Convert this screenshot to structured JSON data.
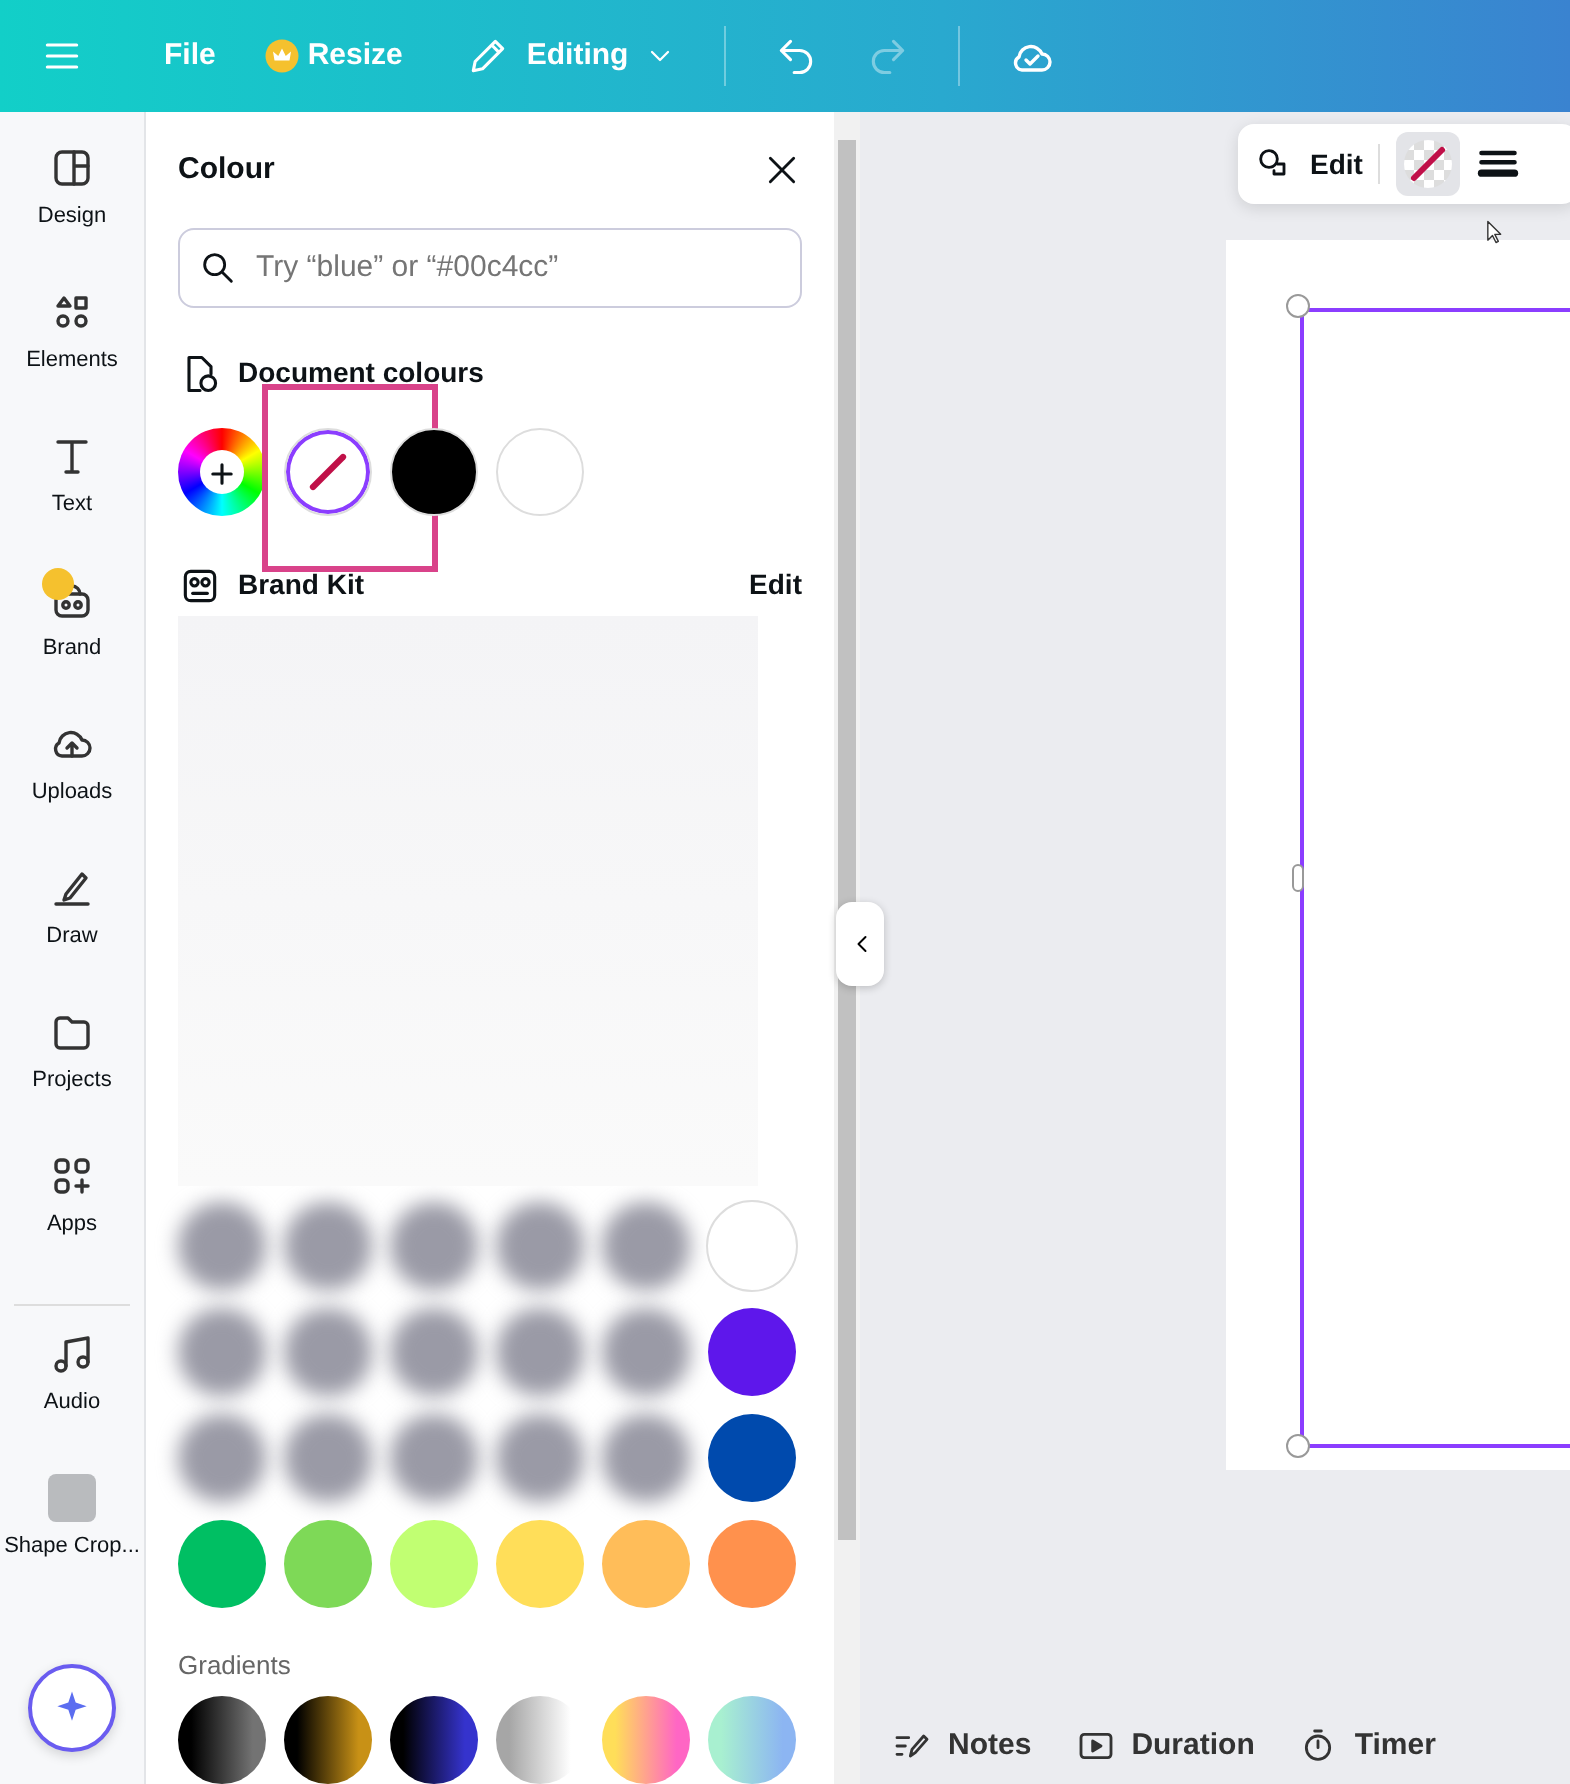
{
  "top_bar": {
    "file_label": "File",
    "resize_label": "Resize",
    "mode_label": "Editing",
    "undo": {
      "disabled": false
    },
    "redo": {
      "disabled": true
    }
  },
  "sidebar": {
    "items": [
      {
        "label": "Design",
        "kind": "design",
        "premium": false
      },
      {
        "label": "Elements",
        "kind": "elements",
        "premium": false
      },
      {
        "label": "Text",
        "kind": "text",
        "premium": false
      },
      {
        "label": "Brand",
        "kind": "brand",
        "premium": true
      },
      {
        "label": "Uploads",
        "kind": "uploads",
        "premium": false
      },
      {
        "label": "Draw",
        "kind": "draw",
        "premium": false
      },
      {
        "label": "Projects",
        "kind": "projects",
        "premium": false
      },
      {
        "label": "Apps",
        "kind": "apps",
        "premium": false
      },
      {
        "label": "Audio",
        "kind": "audio",
        "premium": false
      },
      {
        "label": "Shape Crop...",
        "kind": "thumbnail",
        "premium": false
      }
    ]
  },
  "colour_panel": {
    "title": "Colour",
    "search": {
      "placeholder": "Try “blue” or “#00c4cc”"
    },
    "document_colours": {
      "title": "Document colours",
      "swatches": [
        {
          "kind": "add",
          "selected": false,
          "highlighted": false
        },
        {
          "kind": "transparent",
          "selected": true,
          "highlighted": true
        },
        {
          "kind": "solid",
          "color": "#000000",
          "selected": false,
          "highlighted": false
        },
        {
          "kind": "solid",
          "color": "#ffffff",
          "selected": false,
          "highlighted": false
        }
      ]
    },
    "brand_kit": {
      "title": "Brand Kit",
      "action": "Edit"
    },
    "privacy_blur": true,
    "default_colours": [
      {
        "swatches": [
          {
            "blurred": true
          },
          {
            "blurred": true
          },
          {
            "blurred": true
          },
          {
            "blurred": true
          },
          {
            "blurred": true
          },
          {
            "blurred": false,
            "color": "#ffffff"
          }
        ]
      },
      {
        "swatches": [
          {
            "blurred": true
          },
          {
            "blurred": true
          },
          {
            "blurred": true
          },
          {
            "blurred": true
          },
          {
            "blurred": true
          },
          {
            "blurred": false,
            "color": "#5e17eb"
          }
        ]
      },
      {
        "swatches": [
          {
            "blurred": true
          },
          {
            "blurred": true
          },
          {
            "blurred": true
          },
          {
            "blurred": true
          },
          {
            "blurred": true
          },
          {
            "blurred": false,
            "color": "#004aad"
          }
        ]
      },
      {
        "swatches": [
          {
            "blurred": false,
            "color": "#00bf63"
          },
          {
            "blurred": false,
            "color": "#7ed957"
          },
          {
            "blurred": false,
            "color": "#c1ff72"
          },
          {
            "blurred": false,
            "color": "#ffde59"
          },
          {
            "blurred": false,
            "color": "#ffbd59"
          },
          {
            "blurred": false,
            "color": "#ff914d"
          }
        ]
      }
    ],
    "gradients": {
      "title": "Gradients",
      "swatches": [
        {
          "stops": [
            {
              "color": "#000000"
            },
            {
              "color": "#737373"
            }
          ]
        },
        {
          "stops": [
            {
              "color": "#000000"
            },
            {
              "color": "#c89116"
            }
          ]
        },
        {
          "stops": [
            {
              "color": "#000000"
            },
            {
              "color": "#3533cd"
            }
          ]
        },
        {
          "stops": [
            {
              "color": "#a6a6a6"
            },
            {
              "color": "#ffffff"
            }
          ]
        },
        {
          "stops": [
            {
              "color": "#ffde59"
            },
            {
              "color": "#ff66c4"
            }
          ]
        },
        {
          "stops": [
            {
              "color": "#a8f0d0"
            },
            {
              "color": "#8cb5f2"
            }
          ]
        }
      ]
    }
  },
  "toolbar": {
    "edit_label": "Edit",
    "fill_swatch": {
      "kind": "transparent"
    }
  },
  "bottom_bar": [
    {
      "label": "Notes",
      "kind": "notes"
    },
    {
      "label": "Duration",
      "kind": "duration"
    },
    {
      "label": "Timer",
      "kind": "timer"
    }
  ]
}
